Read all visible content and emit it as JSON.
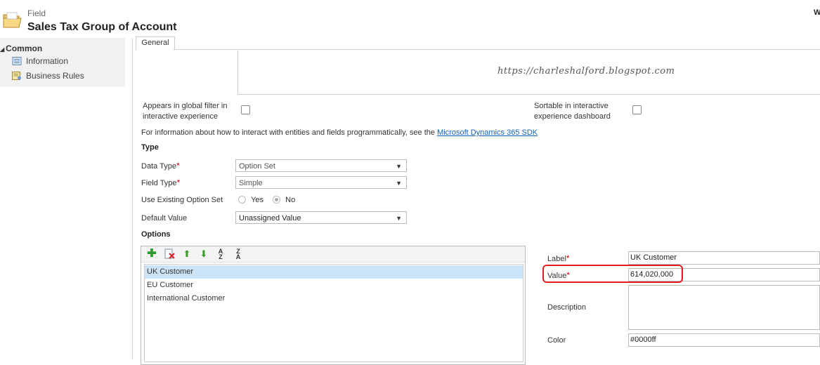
{
  "header": {
    "entity_type": "Field",
    "title": "Sales Tax Group of Account",
    "corner_text": "W"
  },
  "nav": {
    "group": "Common",
    "items": [
      {
        "label": "Information"
      },
      {
        "label": "Business Rules"
      }
    ]
  },
  "tabs": [
    {
      "label": "General"
    }
  ],
  "watermark": "https://charleshalford.blogspot.com",
  "flags": {
    "global_filter_label_1": "Appears in global filter in",
    "global_filter_label_2": "interactive experience",
    "global_filter_checked": false,
    "sortable_label_1": "Sortable in interactive",
    "sortable_label_2": "experience dashboard",
    "sortable_checked": false
  },
  "info": {
    "text": "For information about how to interact with entities and fields programmatically, see the ",
    "link": "Microsoft Dynamics 365 SDK"
  },
  "type_section": {
    "heading": "Type",
    "data_type_label": "Data Type",
    "data_type_value": "Option Set",
    "field_type_label": "Field Type",
    "field_type_value": "Simple",
    "use_existing_label": "Use Existing Option Set",
    "yes_label": "Yes",
    "no_label": "No",
    "selected": "No",
    "default_value_label": "Default Value",
    "default_value": "Unassigned Value",
    "required_marker": "*"
  },
  "options": {
    "heading": "Options",
    "toolbar": [
      "add-icon",
      "delete-icon",
      "move-up-icon",
      "move-down-icon",
      "sort-az-icon",
      "sort-za-icon"
    ],
    "items": [
      {
        "label": "UK Customer",
        "selected": true
      },
      {
        "label": "EU Customer",
        "selected": false
      },
      {
        "label": "International Customer",
        "selected": false
      }
    ]
  },
  "option_detail": {
    "label_label": "Label",
    "label_value": "UK Customer",
    "value_label": "Value",
    "value_value": "614,020,000",
    "description_label": "Description",
    "description_value": "",
    "color_label": "Color",
    "color_value": "#0000ff"
  },
  "colors": {
    "highlight": "#e01c1c",
    "link": "#1160b7",
    "selection": "#cce4f7",
    "required": "#cc0000"
  }
}
